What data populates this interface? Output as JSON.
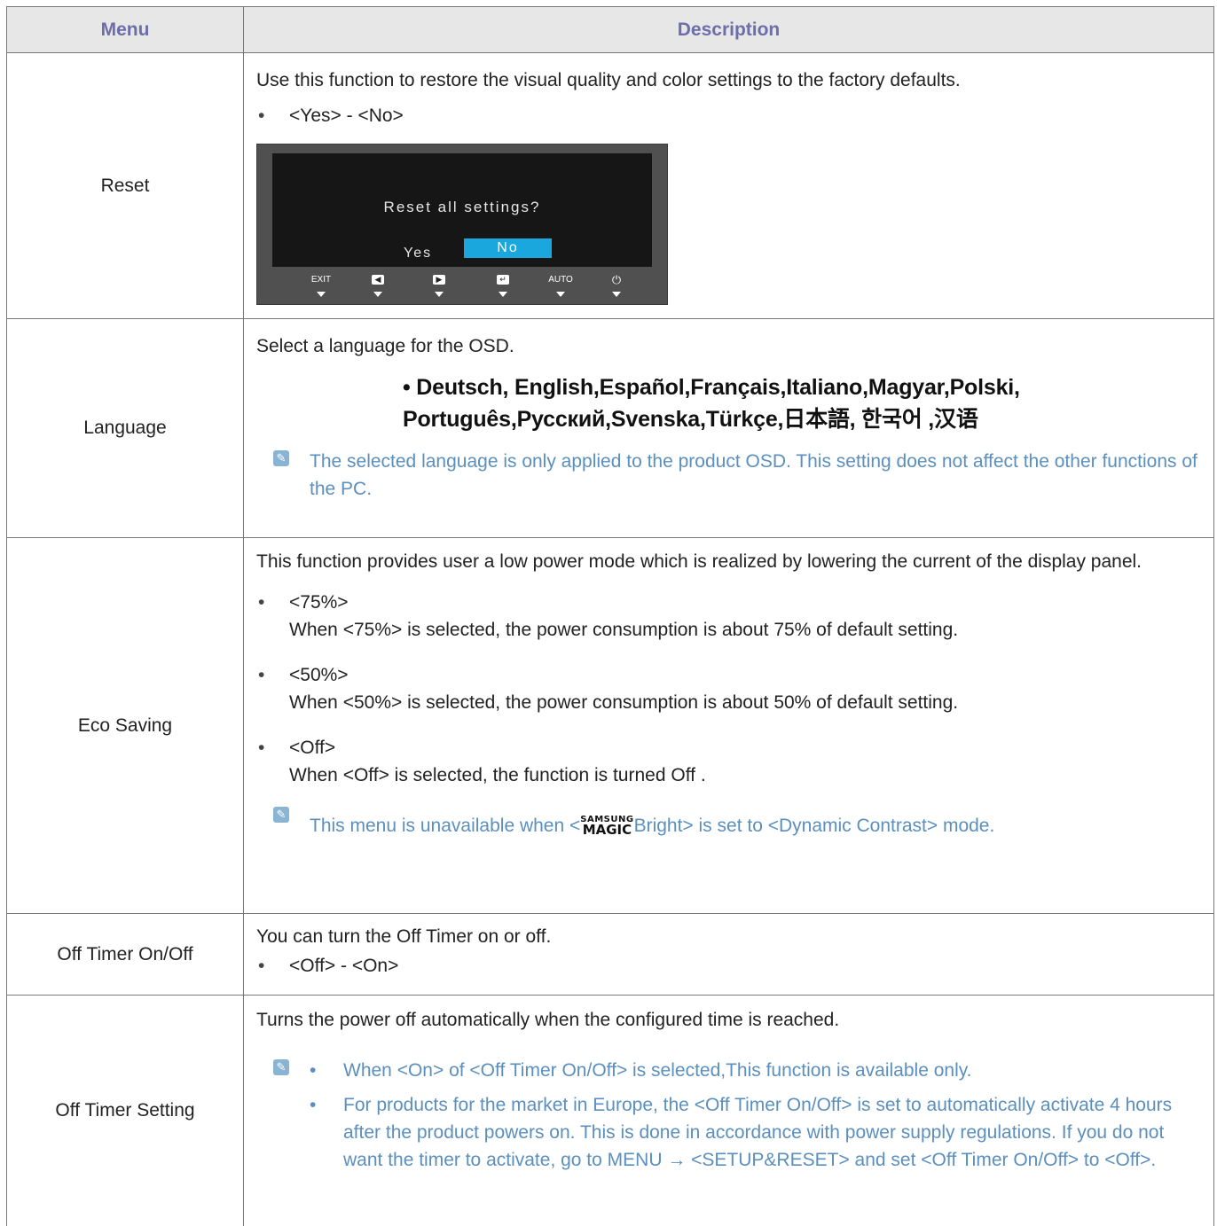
{
  "header": {
    "menu": "Menu",
    "description": "Description"
  },
  "reset": {
    "label": "Reset",
    "text": "Use this function to restore the visual quality and color settings to the factory defaults.",
    "options": "<Yes> - <No>",
    "osd": {
      "question": "Reset all settings?",
      "yes": "Yes",
      "no": "No",
      "buttons": [
        "EXIT",
        "◀",
        "▶",
        "↵",
        "AUTO",
        "⏻"
      ]
    }
  },
  "language": {
    "label": "Language",
    "text": "Select a language for the OSD.",
    "languages_line1": "• Deutsch, English,Español,Français,Italiano,Magyar,Polski,",
    "languages_line2": "Português,Русский,Svenska,Türkçe,日本語, 한국어 ,汉语",
    "note": "The selected language is only applied to the product OSD. This setting does not affect the other functions of the PC."
  },
  "eco": {
    "label": "Eco Saving",
    "text": "This function provides user a low power mode which is realized by lowering the current of the display panel.",
    "items": [
      {
        "title": "<75%>",
        "desc": "When <75%> is selected, the power consumption is about 75% of default setting."
      },
      {
        "title": "<50%>",
        "desc": "When <50%> is selected, the power consumption is about 50% of default setting."
      },
      {
        "title": "<Off>",
        "desc": "When <Off> is selected, the function is turned Off ."
      }
    ],
    "note_before": "This menu is unavailable when <",
    "samsung": "SAMSUNG",
    "magic": "MAGIC",
    "note_after": "Bright> is set to <Dynamic Contrast> mode."
  },
  "timer_onoff": {
    "label": "Off Timer On/Off",
    "text": "You can turn the Off Timer on or off.",
    "options": "<Off> - <On>"
  },
  "timer_setting": {
    "label": "Off Timer Setting",
    "text": "Turns the power off automatically when the configured time is reached.",
    "notes": [
      "When <On> of <Off Timer On/Off> is selected,This function is available only.",
      "For products for the market in Europe, the <Off Timer On/Off> is set to automatically activate 4 hours after the product powers on. This is done in accordance with power supply regulations. If you do not want the timer to activate, go to MENU → <SETUP&RESET> and set <Off Timer On/Off> to <Off>."
    ]
  },
  "icons": {
    "note": "note-icon",
    "bullet": "bullet"
  }
}
